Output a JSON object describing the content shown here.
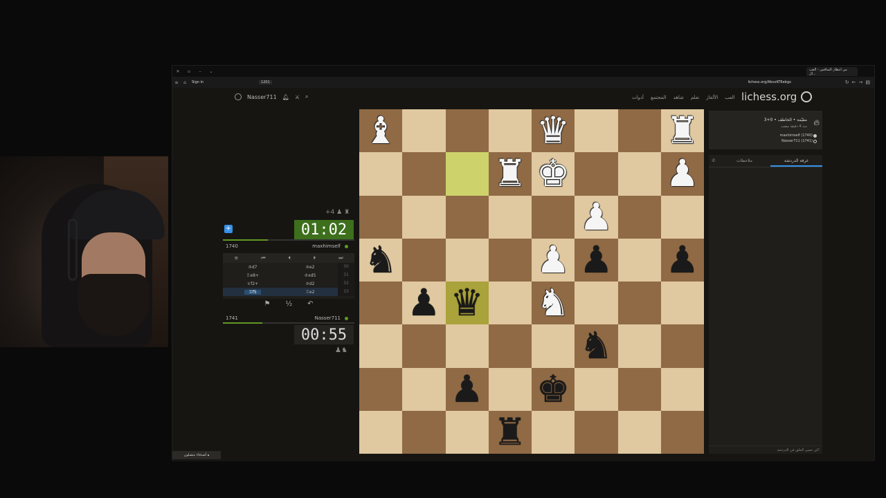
{
  "browser": {
    "signin": "Sign in",
    "badge": "1201",
    "url": "lichess.org/AbvxKT6ebgx",
    "tab_title": "من انتظار المنافس - العب ال..."
  },
  "site": {
    "username": "Nasser711",
    "nav": [
      "أدوات",
      "المجتمع",
      "شاهد",
      "تعلم",
      "الألغاز",
      "العب"
    ],
    "logo": "lichess.org"
  },
  "board": {
    "highlight": [
      "c7",
      "c4"
    ],
    "pieces": {
      "a8": "wB",
      "e8": "wQ",
      "h8": "wR",
      "d7": "wR",
      "e7": "wK",
      "h7": "wP",
      "f6": "wP",
      "a5": "bN",
      "e5": "wP",
      "f5": "bP",
      "h5": "bP",
      "b4": "bP",
      "c4": "bQ",
      "e4": "wN",
      "f3": "bN",
      "c2": "bP",
      "e2": "bK",
      "d1": "bR"
    }
  },
  "top_player": {
    "clock": "01:02",
    "rating": "1740",
    "name": "maxhimself",
    "material": "+4",
    "time_fraction": 0.34
  },
  "bottom_player": {
    "clock": "00:55",
    "rating": "1741",
    "name": "Nasser711",
    "time_fraction": 0.3
  },
  "moves": [
    {
      "n": "30",
      "white": "♔e2",
      "black": "♔d7"
    },
    {
      "n": "31",
      "white": "♔xd5",
      "black": "♖e8+"
    },
    {
      "n": "32",
      "white": "♔d2",
      "black": "♕f2+"
    },
    {
      "n": "33",
      "white": "♖e2",
      "black": "♖f5",
      "current": true
    }
  ],
  "info": {
    "game_type": "3+0 • مقيّمة • الخاطف",
    "ago": "منذ 4 دقيقة مضت",
    "white_player": "maxhimself (1740)",
    "black_player": "Nasser711 (1741)"
  },
  "chat": {
    "tab_room": "غرفة الدردشة",
    "tab_notes": "ملاحظات",
    "input": "كن حسن الخلق في الدردشة!"
  },
  "friends": "أصدقاء متصلون"
}
